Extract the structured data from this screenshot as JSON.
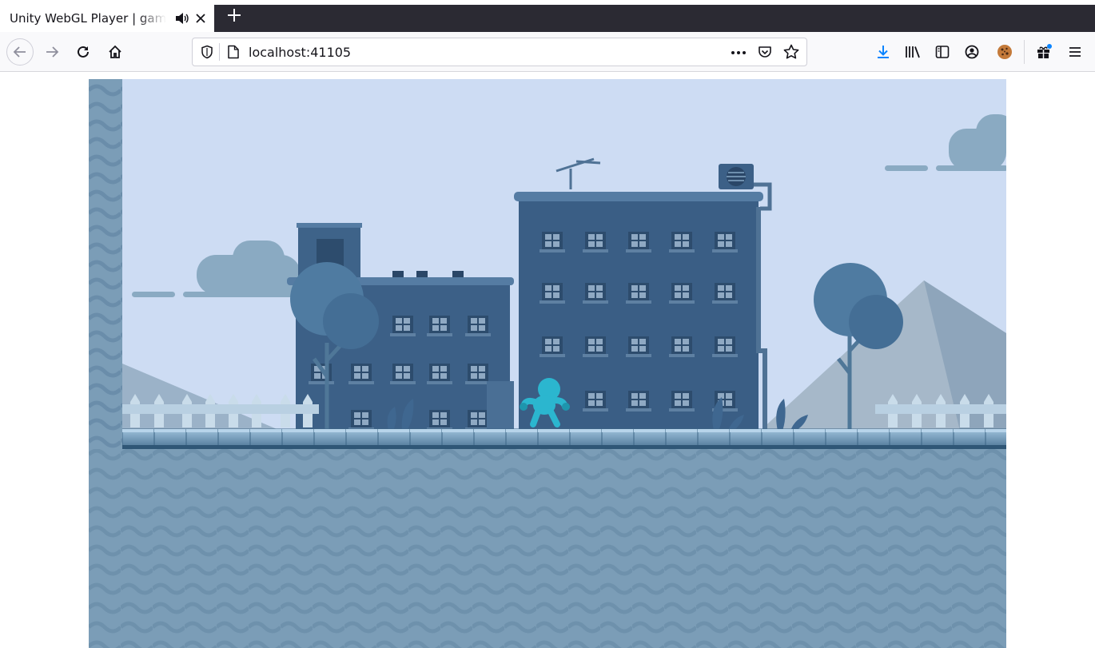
{
  "browser": {
    "tab": {
      "title": "Unity WebGL Player | game",
      "audio_icon": "speaker-icon",
      "close_icon": "close-icon"
    },
    "new_tab_icon": "plus-icon",
    "nav": {
      "back_icon": "arrow-left-icon",
      "forward_icon": "arrow-right-icon",
      "reload_icon": "reload-icon",
      "home_icon": "home-icon"
    },
    "urlbar": {
      "url": "localhost:41105",
      "shield_icon": "shield-icon",
      "page_icon": "page-icon",
      "more_icon": "ellipsis-icon",
      "pocket_icon": "pocket-icon",
      "bookmark_icon": "star-icon"
    },
    "toolbar_icons": [
      "download-icon",
      "library-icon",
      "sidebar-icon",
      "account-icon",
      "cookie-icon",
      "gift-icon",
      "menu-icon"
    ]
  },
  "colors": {
    "sky": "#cddcf3",
    "building": "#375b80",
    "ground": "#7a9cb5",
    "player": "#2bb6cf",
    "accent": "#0a84ff"
  },
  "game": {
    "engine": "Unity WebGL",
    "player_icon": "player-character-icon"
  }
}
